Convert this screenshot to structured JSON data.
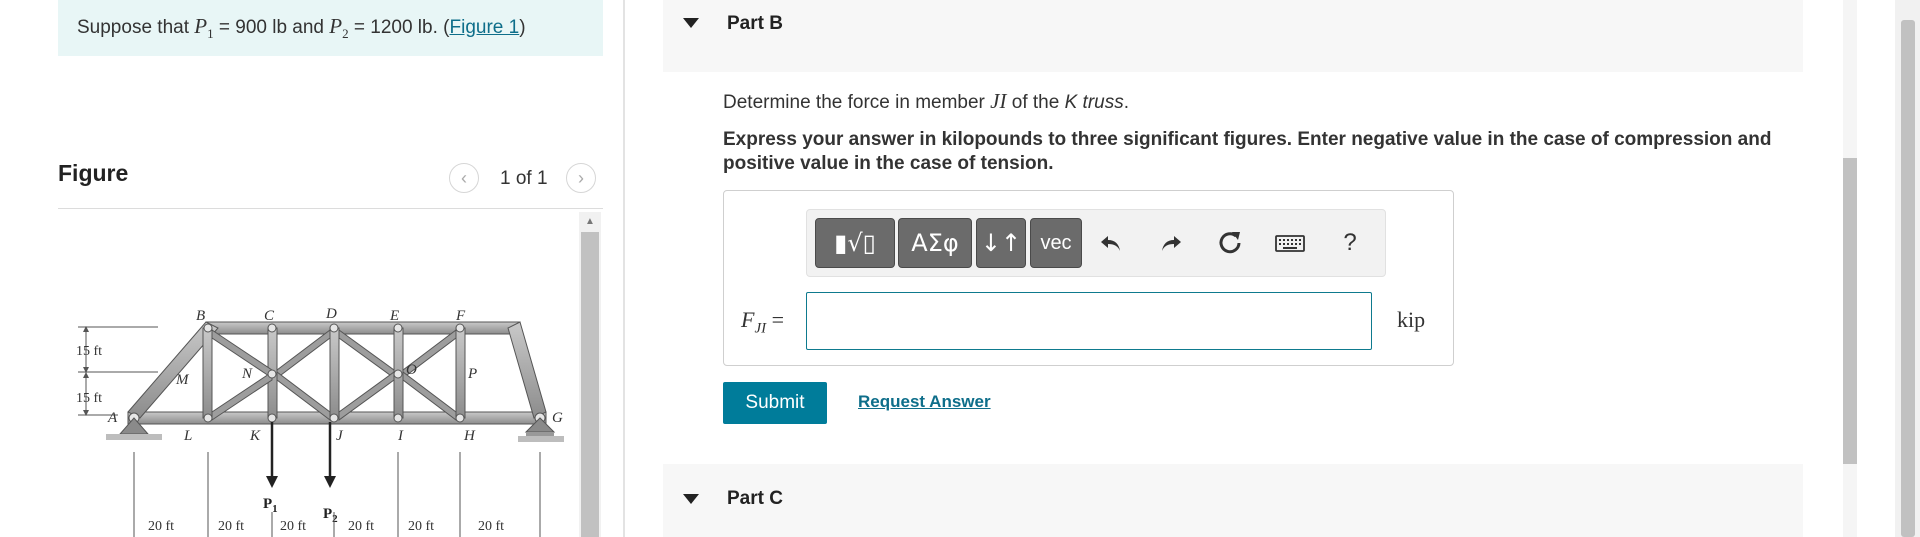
{
  "problem": {
    "text_before": "Suppose that ",
    "p1_symbol": "P",
    "p1_sub": "1",
    "p1_value": " = 900 lb",
    "and": " and ",
    "p2_symbol": "P",
    "p2_sub": "2",
    "p2_value": " = 1200 lb",
    "period": ". (",
    "figure_link": "Figure 1",
    "close": ")"
  },
  "figure": {
    "heading": "Figure",
    "count": "1 of 1",
    "joint_labels": [
      "A",
      "B",
      "C",
      "D",
      "E",
      "F",
      "G",
      "H",
      "I",
      "J",
      "K",
      "L",
      "M",
      "N",
      "O",
      "P"
    ],
    "height_labels": [
      "15 ft",
      "15 ft"
    ],
    "load_labels": {
      "p1": "P",
      "p1_sub": "1",
      "p2": "P",
      "p2_sub": "2"
    },
    "span_labels": [
      "20 ft",
      "20 ft",
      "20 ft",
      "20 ft",
      "20 ft",
      "20 ft"
    ]
  },
  "part_b": {
    "title": "Part B",
    "question_before": "Determine the force in member ",
    "member": "JI",
    "question_mid": " of the ",
    "truss": "K truss",
    "question_end": ".",
    "instructions": "Express your answer in kilopounds to three significant figures. Enter negative value in the case of compression and positive value in the case of tension.",
    "toolbar": {
      "templates_label": "▮√▯",
      "greek_label": "ΑΣφ",
      "arrows_label": "↓↑",
      "vec_label": "vec",
      "help_label": "?"
    },
    "answer_label_main": "F",
    "answer_label_sub": "JI",
    "answer_equals": " =",
    "answer_value": "",
    "unit": "kip",
    "submit_label": "Submit",
    "request_answer_label": "Request Answer"
  },
  "part_c": {
    "title": "Part C"
  },
  "colors": {
    "accent": "#007c9a",
    "link": "#0e6e8a",
    "problem_bg": "#e8f6f6",
    "header_bg": "#f7f7f7"
  }
}
